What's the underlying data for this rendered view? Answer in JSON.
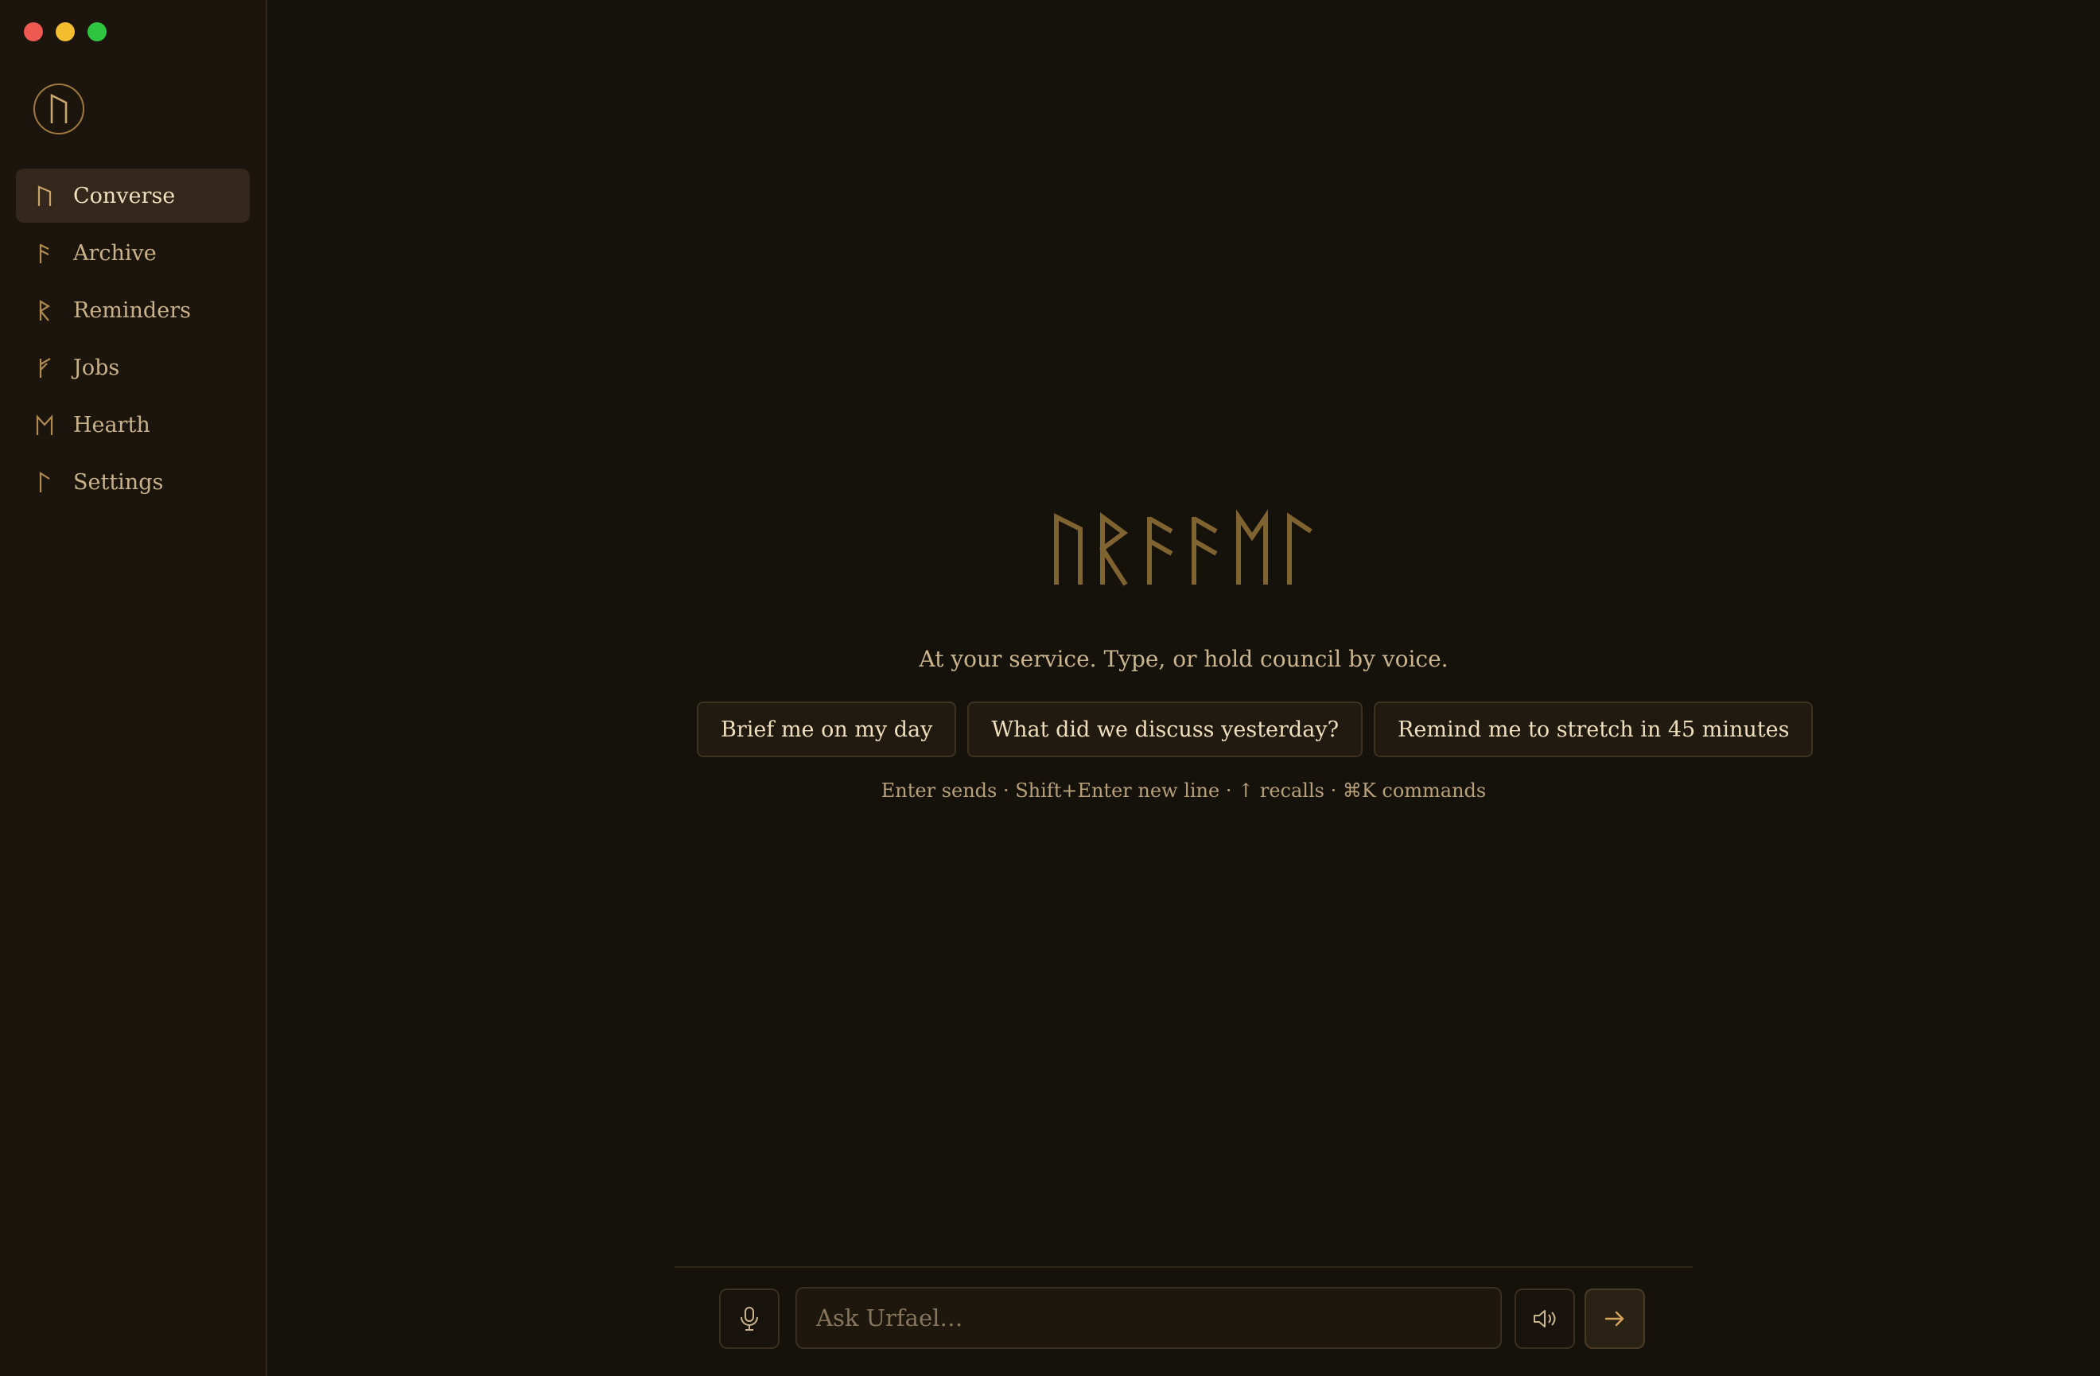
{
  "window": {
    "controls": [
      "close",
      "minimize",
      "maximize"
    ]
  },
  "sidebar": {
    "logo_icon": "rune-ur-icon",
    "items": [
      {
        "label": "Converse",
        "icon": "rune-ur-icon",
        "active": true
      },
      {
        "label": "Archive",
        "icon": "rune-ansuz-icon",
        "active": false
      },
      {
        "label": "Reminders",
        "icon": "rune-raido-icon",
        "active": false
      },
      {
        "label": "Jobs",
        "icon": "rune-algiz-icon",
        "active": false
      },
      {
        "label": "Hearth",
        "icon": "rune-ehwaz-icon",
        "active": false
      },
      {
        "label": "Settings",
        "icon": "rune-laguz-icon",
        "active": false
      }
    ]
  },
  "main": {
    "rune_wordmark": "ᚢᚱᚠᚨᛖᛚ",
    "tagline": "At your service. Type, or hold council by voice.",
    "suggestions": [
      "Brief me on my day",
      "What did we discuss yesterday?",
      "Remind me to stretch in 45 minutes"
    ],
    "hint": "Enter sends · Shift+Enter new line · ↑ recalls · ⌘K commands"
  },
  "composer": {
    "placeholder": "Ask Urfael…",
    "value": "",
    "mic_icon": "microphone-icon",
    "speaker_icon": "speaker-icon",
    "send_icon": "arrow-right-icon"
  },
  "colors": {
    "background": "#15110b",
    "sidebar": "#1b150d",
    "accent": "#a07a3e",
    "text": "#d8c29a",
    "traffic_red": "#ee5a52",
    "traffic_yellow": "#f4bd2f",
    "traffic_green": "#2fc540"
  }
}
